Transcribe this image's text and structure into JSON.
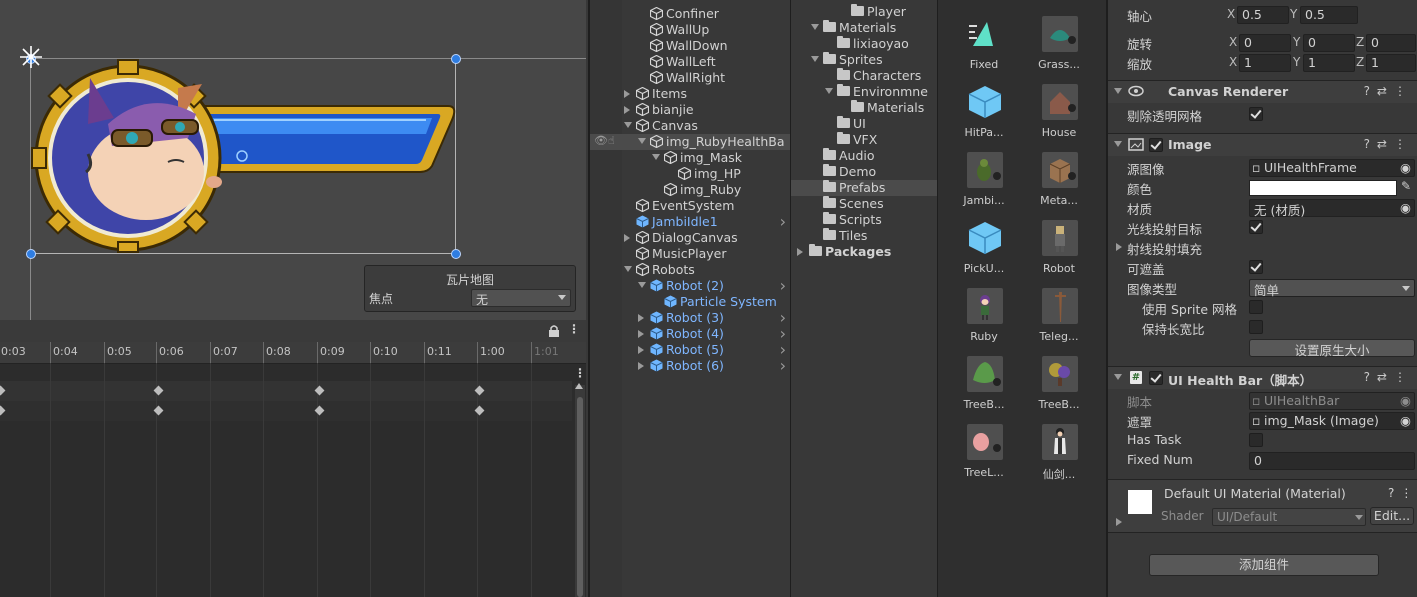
{
  "scene": {
    "tilemap_panel": {
      "title": "瓦片地图",
      "focus_label": "焦点",
      "focus_value": "无"
    }
  },
  "timeline": {
    "ticks": [
      "0:03",
      "0:04",
      "0:05",
      "0:06",
      "0:07",
      "0:08",
      "0:09",
      "0:10",
      "0:11",
      "1:00",
      "1:01"
    ]
  },
  "hierarchy": {
    "items": [
      {
        "label": "Confiner",
        "prefab": false
      },
      {
        "label": "WallUp",
        "prefab": false
      },
      {
        "label": "WallDown",
        "prefab": false
      },
      {
        "label": "WallLeft",
        "prefab": false
      },
      {
        "label": "WallRight",
        "prefab": false
      },
      {
        "label": "Items",
        "prefab": false
      },
      {
        "label": "bianjie",
        "prefab": false
      },
      {
        "label": "Canvas",
        "prefab": false
      },
      {
        "label": "img_RubyHealthBa",
        "prefab": false
      },
      {
        "label": "img_Mask",
        "prefab": false
      },
      {
        "label": "img_HP",
        "prefab": false
      },
      {
        "label": "img_Ruby",
        "prefab": false
      },
      {
        "label": "EventSystem",
        "prefab": false
      },
      {
        "label": "JambiIdle1",
        "prefab": true
      },
      {
        "label": "DialogCanvas",
        "prefab": false
      },
      {
        "label": "MusicPlayer",
        "prefab": false
      },
      {
        "label": "Robots",
        "prefab": false
      },
      {
        "label": "Robot (2)",
        "prefab": true
      },
      {
        "label": "Particle System",
        "prefab": true
      },
      {
        "label": "Robot (3)",
        "prefab": true
      },
      {
        "label": "Robot (4)",
        "prefab": true
      },
      {
        "label": "Robot (5)",
        "prefab": true
      },
      {
        "label": "Robot (6)",
        "prefab": true
      }
    ]
  },
  "project": {
    "folders": [
      {
        "label": "Player"
      },
      {
        "label": "Materials"
      },
      {
        "label": "lixiaoyao"
      },
      {
        "label": "Sprites"
      },
      {
        "label": "Characters"
      },
      {
        "label": "Environmne"
      },
      {
        "label": "Materials"
      },
      {
        "label": "UI"
      },
      {
        "label": "VFX"
      },
      {
        "label": "Audio"
      },
      {
        "label": "Demo"
      },
      {
        "label": "Prefabs"
      },
      {
        "label": "Scenes"
      },
      {
        "label": "Scripts"
      },
      {
        "label": "Tiles"
      },
      {
        "label": "Packages"
      }
    ]
  },
  "assets": {
    "items": [
      {
        "label": "Fixed",
        "icon": "teal-arrow-icon"
      },
      {
        "label": "Grass...",
        "icon": "grass-icon"
      },
      {
        "label": "HitPa...",
        "icon": "prefab-cube-icon"
      },
      {
        "label": "House",
        "icon": "house-icon"
      },
      {
        "label": "Jambi...",
        "icon": "jambi-icon"
      },
      {
        "label": "Meta...",
        "icon": "crate-icon"
      },
      {
        "label": "PickU...",
        "icon": "prefab-cube-icon"
      },
      {
        "label": "Robot",
        "icon": "robot-icon"
      },
      {
        "label": "Ruby",
        "icon": "ruby-icon"
      },
      {
        "label": "Teleg...",
        "icon": "pole-icon"
      },
      {
        "label": "TreeB...",
        "icon": "tree-icon"
      },
      {
        "label": "TreeB...",
        "icon": "tree-purple-icon"
      },
      {
        "label": "TreeL...",
        "icon": "tree-pink-icon"
      },
      {
        "label": "仙剑...",
        "icon": "character-icon"
      }
    ]
  },
  "inspector": {
    "pivot": {
      "label": "轴心",
      "x": "0.5",
      "y": "0.5"
    },
    "rotation": {
      "label": "旋转",
      "x": "0",
      "y": "0",
      "z": "0"
    },
    "scale": {
      "label": "缩放",
      "x": "1",
      "y": "1",
      "z": "1"
    },
    "axis": {
      "x": "X",
      "y": "Y",
      "z": "Z"
    },
    "canvas_renderer": {
      "title": "Canvas Renderer",
      "cull_label": "剔除透明网格"
    },
    "image": {
      "title": "Image",
      "source_label": "源图像",
      "source_value": "UIHealthFrame",
      "color_label": "颜色",
      "material_label": "材质",
      "material_value": "无 (材质)",
      "raycast_label": "光线投射目标",
      "raycast_padding_label": "射线投射填充",
      "maskable_label": "可遮盖",
      "image_type_label": "图像类型",
      "image_type_value": "简单",
      "use_sprite_mesh_label": "使用 Sprite 网格",
      "preserve_aspect_label": "保持长宽比",
      "native_size_button": "设置原生大小"
    },
    "script_comp": {
      "title": "UI Health Bar（脚本）",
      "script_label": "脚本",
      "script_value": "UIHealthBar",
      "mask_label": "遮罩",
      "mask_value": "img_Mask (Image)",
      "has_task_label": "Has Task",
      "fixed_num_label": "Fixed Num",
      "fixed_num_value": "0"
    },
    "material": {
      "title": "Default UI Material (Material)",
      "shader_label": "Shader",
      "shader_value": "UI/Default",
      "edit_button": "Edit..."
    },
    "add_component_button": "添加组件"
  },
  "colors": {
    "accent_blue": "#2f7de1",
    "prefab_text": "#7fb6ff",
    "panel_bg": "#383838"
  }
}
